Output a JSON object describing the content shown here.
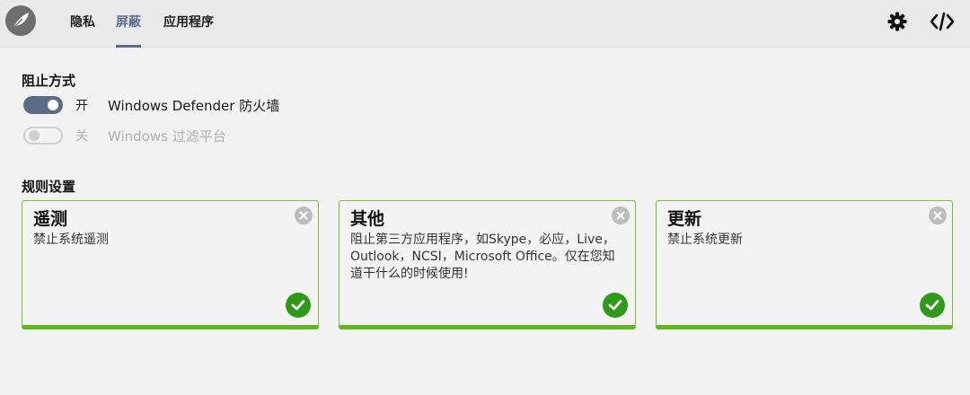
{
  "nav": {
    "tabs": [
      {
        "label": "隐私",
        "active": false
      },
      {
        "label": "屏蔽",
        "active": true
      },
      {
        "label": "应用程序",
        "active": false
      }
    ],
    "icons": [
      "feather-logo-icon",
      "gear-icon",
      "code-icon"
    ]
  },
  "blocking_method": {
    "title": "阻止方式",
    "options": [
      {
        "state": "开",
        "label": "Windows Defender 防火墙",
        "enabled": true
      },
      {
        "state": "关",
        "label": "Windows 过滤平台",
        "enabled": false
      }
    ]
  },
  "rule_settings": {
    "title": "规则设置",
    "cards": [
      {
        "title": "遥测",
        "description": "禁止系统遥测",
        "checked": true
      },
      {
        "title": "其他",
        "description": "阻止第三方应用程序，如Skype，必应，Live，Outlook，NCSI，Microsoft Office。仅在您知道干什么的时候使用!",
        "checked": true
      },
      {
        "title": "更新",
        "description": "禁止系统更新",
        "checked": true
      }
    ]
  },
  "colors": {
    "accent": "#5a6f8e",
    "card_border": "#72c32c",
    "check": "#2f9a1a"
  }
}
